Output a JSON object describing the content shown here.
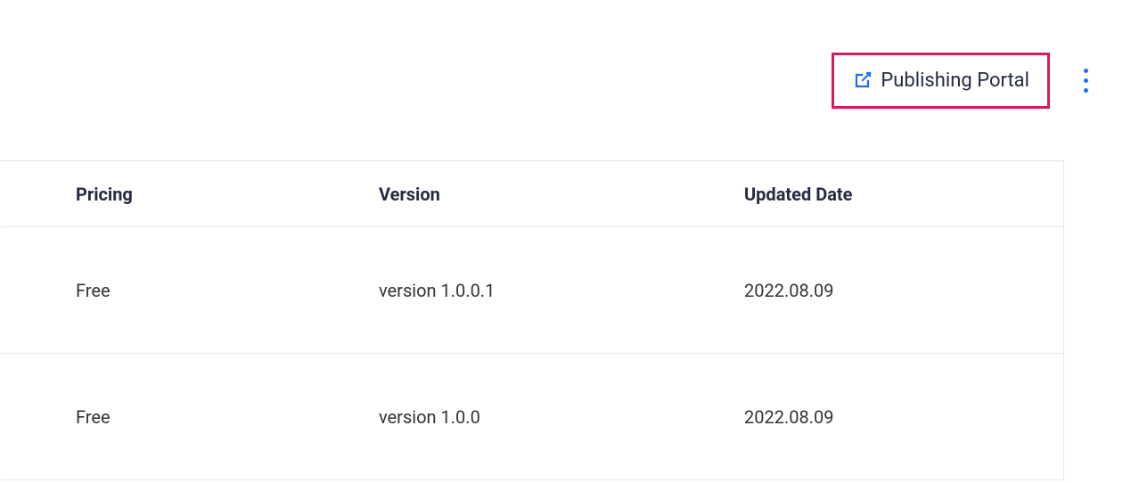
{
  "toolbar": {
    "portal_label": "Publishing Portal"
  },
  "table": {
    "headers": {
      "pricing": "Pricing",
      "version": "Version",
      "updated": "Updated Date"
    },
    "rows": [
      {
        "pricing": "Free",
        "version": "version 1.0.0.1",
        "updated": "2022.08.09"
      },
      {
        "pricing": "Free",
        "version": "version 1.0.0",
        "updated": "2022.08.09"
      }
    ]
  }
}
